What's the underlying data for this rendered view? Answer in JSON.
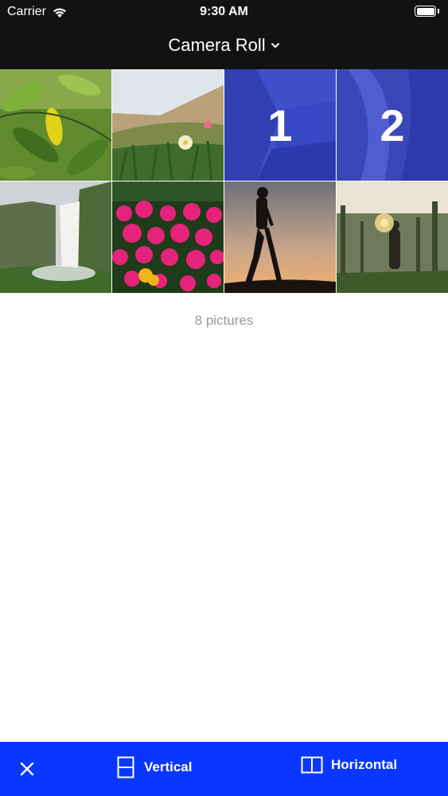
{
  "status_bar": {
    "carrier": "Carrier",
    "time": "9:30 AM",
    "wifi_icon": "wifi-icon",
    "battery_icon": "battery-icon"
  },
  "nav": {
    "title": "Camera Roll",
    "title_icon": "chevron-down-icon"
  },
  "photos": [
    {
      "desc_icon": "leaves-photo",
      "selected": false,
      "number": ""
    },
    {
      "desc_icon": "dune-flowers-photo",
      "selected": false,
      "number": ""
    },
    {
      "desc_icon": "coast-photo",
      "selected": true,
      "number": "1"
    },
    {
      "desc_icon": "river-photo",
      "selected": true,
      "number": "2"
    },
    {
      "desc_icon": "waterfall-photo",
      "selected": false,
      "number": ""
    },
    {
      "desc_icon": "pink-flowers-photo",
      "selected": false,
      "number": ""
    },
    {
      "desc_icon": "silhouette-photo",
      "selected": false,
      "number": ""
    },
    {
      "desc_icon": "forest-sparkler-photo",
      "selected": false,
      "number": ""
    }
  ],
  "footer_count": "8 pictures",
  "bottom_bar": {
    "close_icon": "close-icon",
    "vertical_label": "Vertical",
    "vertical_icon": "vertical-layout-icon",
    "horizontal_label": "Horizontal",
    "horizontal_icon": "horizontal-layout-icon"
  },
  "colors": {
    "nav_background": "#121212",
    "accent": "#0a37ff",
    "selection_overlay": "#1a2fd6",
    "muted_text": "#9a9a9a"
  }
}
